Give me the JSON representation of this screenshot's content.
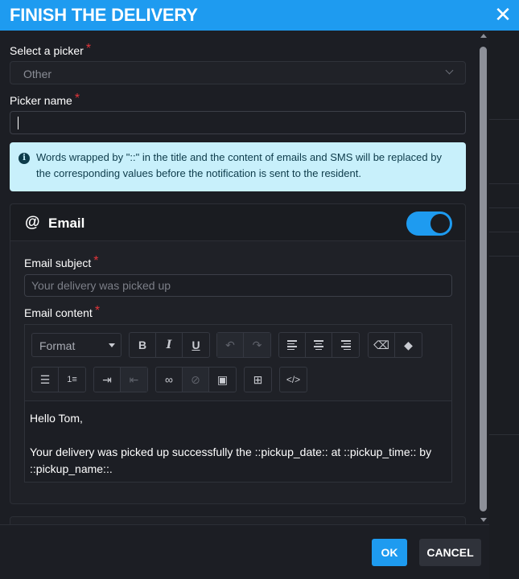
{
  "dialog": {
    "title": "FINISH THE DELIVERY",
    "close_icon": "close-icon"
  },
  "picker": {
    "label": "Select a picker",
    "required_mark": "*",
    "value": "Other"
  },
  "picker_name": {
    "label": "Picker name",
    "required_mark": "*",
    "value": ""
  },
  "info": {
    "icon": "info-icon",
    "text": "Words wrapped by \"::\" in the title and the content of emails and SMS will be replaced by the corresponding values before the notification is sent to the resident."
  },
  "email": {
    "title": "Email",
    "enabled": true,
    "subject_label": "Email subject",
    "subject_placeholder": "Your delivery was picked up",
    "content_label": "Email content",
    "required_mark": "*",
    "toolbar": {
      "format_label": "Format",
      "bold": "B",
      "italic": "I",
      "underline": "U",
      "source_code": "</>"
    },
    "content_lines": [
      "Hello Tom,",
      "",
      "Your delivery was picked up successfully the ::pickup_date:: at ::pickup_time:: by ::pickup_name::."
    ]
  },
  "sms": {
    "enabled": false
  },
  "footer": {
    "ok_label": "OK",
    "cancel_label": "CANCEL"
  },
  "colors": {
    "accent": "#1e9bf0",
    "info_bg": "#c8f0fb",
    "required": "#e0353a",
    "dialog_bg": "#1c1e24"
  }
}
